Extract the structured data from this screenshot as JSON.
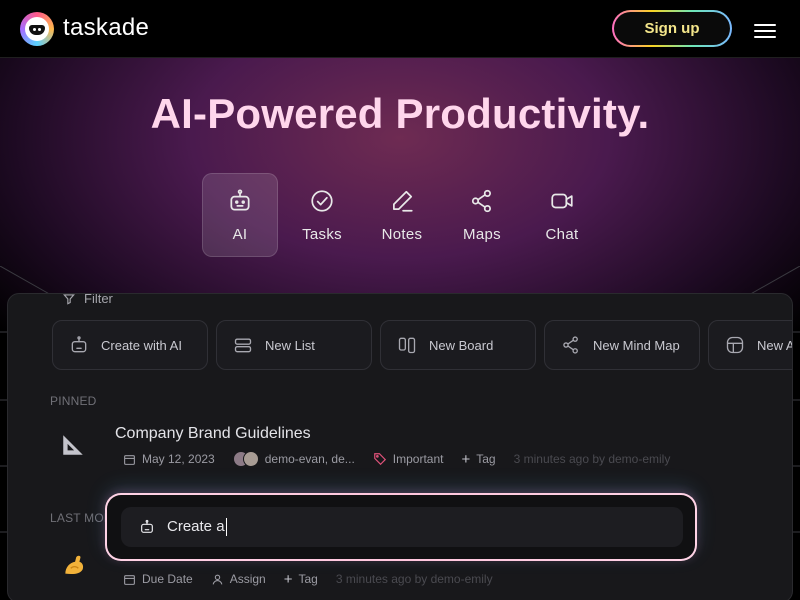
{
  "header": {
    "brand": "taskade",
    "signup_label": "Sign up"
  },
  "hero": {
    "title": "AI-Powered Productivity.",
    "modes": [
      {
        "label": "AI",
        "icon": "robot-icon",
        "active": true
      },
      {
        "label": "Tasks",
        "icon": "check-circle-icon",
        "active": false
      },
      {
        "label": "Notes",
        "icon": "pencil-icon",
        "active": false
      },
      {
        "label": "Maps",
        "icon": "share-nodes-icon",
        "active": false
      },
      {
        "label": "Chat",
        "icon": "video-icon",
        "active": false
      }
    ]
  },
  "workspace": {
    "filter_label": "Filter",
    "actions": [
      {
        "label": "Create with AI",
        "icon": "robot-icon"
      },
      {
        "label": "New List",
        "icon": "list-icon"
      },
      {
        "label": "New Board",
        "icon": "board-icon"
      },
      {
        "label": "New Mind Map",
        "icon": "mind-map-icon"
      },
      {
        "label": "New A",
        "icon": "globe-icon"
      }
    ],
    "pinned_label": "PINNED",
    "pinned_item": {
      "title": "Company Brand Guidelines",
      "date": "May 12, 2023",
      "members": "demo-evan, de...",
      "tag": "Important",
      "add_tag": "Tag",
      "activity": "3 minutes ago by demo-emily"
    },
    "last_modified_label": "LAST MOD",
    "last_item": {
      "due_date": "Due Date",
      "assign": "Assign",
      "add_tag": "Tag",
      "activity": "3 minutes ago by demo-emily"
    }
  },
  "prompt": {
    "value": "Create a"
  },
  "colors": {
    "accent_pink": "#ffd6ec",
    "signup_text": "#f3e58a",
    "panel_bg": "#18181b"
  }
}
